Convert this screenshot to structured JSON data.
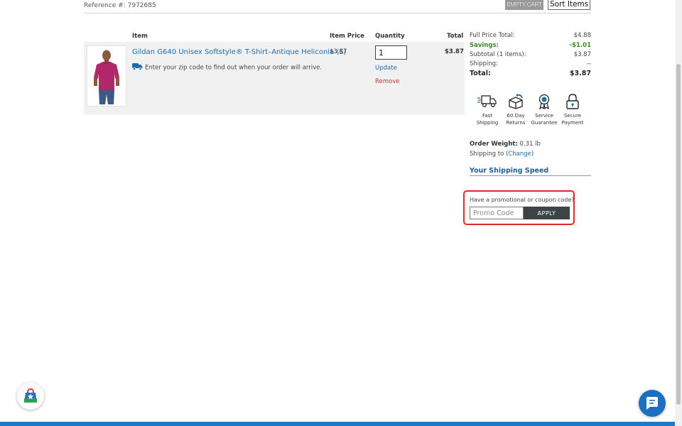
{
  "header": {
    "reference": "Reference #: 7972685",
    "empty_cart_label": "EMPTY CART",
    "sort_items_label": "Sort Items"
  },
  "table": {
    "headers": {
      "item": "Item",
      "item_price": "Item Price",
      "quantity": "Quantity",
      "total": "Total"
    },
    "row": {
      "title": "Gildan G640 Unisex Softstyle® T-Shirt–Antique Heliconia (S)",
      "zip_note": "Enter your zip code to find out when your order will arrive.",
      "price": "$3.87",
      "quantity": "1",
      "update_label": "Update",
      "remove_label": "Remove",
      "total": "$3.87",
      "shirt_color": "#b0286a"
    }
  },
  "summary": {
    "full_price_label": "Full Price Total:",
    "full_price_value": "$4.88",
    "savings_label": "Savings:",
    "savings_value": "-$1.01",
    "subtotal_label": "Subtotal (1 items):",
    "subtotal_value": "$3.87",
    "shipping_label": "Shipping:",
    "shipping_value": "--",
    "total_label": "Total:",
    "total_value": "$3.87"
  },
  "features": [
    {
      "line1": "Fast",
      "line2": "Shipping",
      "icon": "truck-icon"
    },
    {
      "line1": "60 Day",
      "line2": "Returns",
      "icon": "box-return-icon"
    },
    {
      "line1": "Service",
      "line2": "Guarantee",
      "icon": "ribbon-icon"
    },
    {
      "line1": "Secure",
      "line2": "Payment",
      "icon": "lock-icon"
    }
  ],
  "shipping": {
    "weight_label": "Order Weight:",
    "weight_value": "0.31 lb",
    "shipping_to_label": "Shipping to (",
    "change_label": "Change",
    "shipping_to_close": ")",
    "speed_label": "Your Shipping Speed"
  },
  "promo": {
    "label": "Have a promotional or coupon code?",
    "placeholder": "Promo Code",
    "apply_label": "APPLY"
  },
  "colors": {
    "link": "#1f6ca6",
    "savings": "#3a8a1e",
    "remove": "#c9302c",
    "highlight_border": "#e0282c",
    "bottom_bar": "#1f78c8"
  }
}
